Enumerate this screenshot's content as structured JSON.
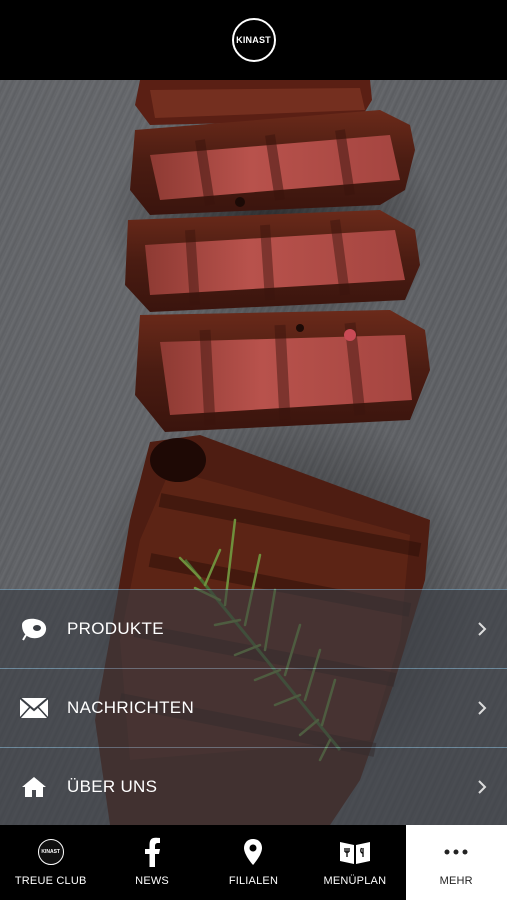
{
  "header": {
    "logo": {
      "brand": "KINAST",
      "animals": "▲■▲",
      "tagline": ""
    }
  },
  "hero": {
    "image": "grilled-steak-with-rosemary-on-slate"
  },
  "menu": {
    "items": [
      {
        "label": "PRODUKTE",
        "icon": "meat-icon"
      },
      {
        "label": "NACHRICHTEN",
        "icon": "envelope-icon"
      },
      {
        "label": "ÜBER UNS",
        "icon": "home-icon"
      }
    ]
  },
  "tabbar": {
    "tabs": [
      {
        "label": "TREUE CLUB",
        "icon": "kinast-logo-icon",
        "active": false
      },
      {
        "label": "NEWS",
        "icon": "facebook-icon",
        "active": false
      },
      {
        "label": "FILIALEN",
        "icon": "location-pin-icon",
        "active": false
      },
      {
        "label": "MENÜPLAN",
        "icon": "menu-book-icon",
        "active": false
      },
      {
        "label": "MEHR",
        "icon": "more-dots-icon",
        "active": true
      }
    ],
    "mini_logo": "KINAST"
  },
  "colors": {
    "background": "#000000",
    "slate": "#5f6165",
    "menu_overlay": "rgba(58,62,68,0.62)",
    "separator": "#78aac8",
    "active_tab_bg": "#ffffff"
  }
}
